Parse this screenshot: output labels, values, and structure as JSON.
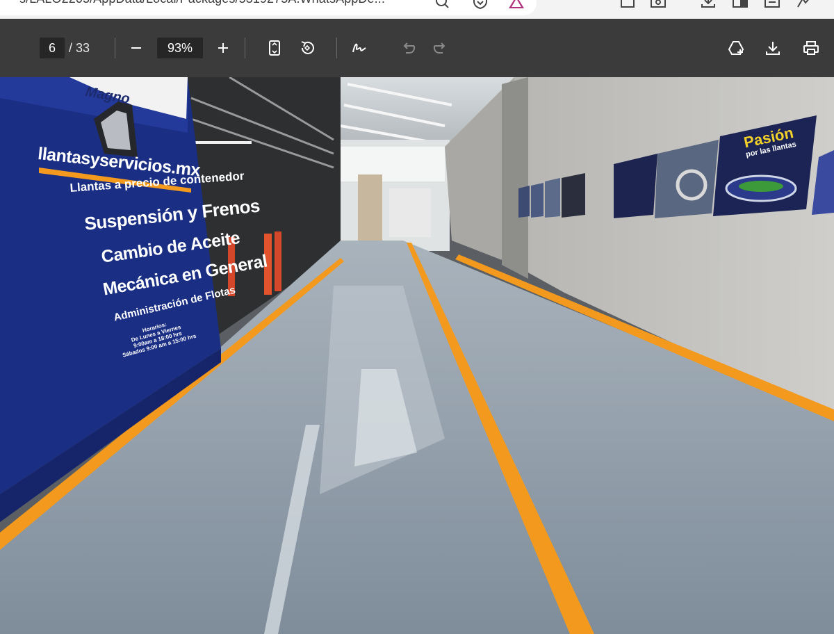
{
  "browser": {
    "address": "s/LALO2205/AppData/Local/Packages/5319275A.WhatsAppDe...",
    "icons": [
      "search-icon",
      "shield-icon",
      "warning-triangle-icon",
      "extensions-icon",
      "screenshot-icon",
      "downloads-icon",
      "split-screen-icon",
      "collections-icon",
      "copilot-icon"
    ]
  },
  "toolbar": {
    "current_page": "6",
    "page_total": "/ 33",
    "zoom": "93%",
    "icons": [
      "zoom-out-icon",
      "zoom-in-icon",
      "fit-page-icon",
      "rotate-icon",
      "draw-icon",
      "undo-icon",
      "redo-icon",
      "add-to-drive-icon",
      "download-icon",
      "print-icon"
    ]
  },
  "photo": {
    "sign": {
      "brand": "Magno",
      "site": "llantasyservicios.mx",
      "line1": "Llantas a precio de contenedor",
      "line2": "Suspensión y Frenos",
      "line3": "Cambio de Aceite",
      "line4": "Mecánica en General",
      "line5": "Administración de Flotas",
      "hours_title": "Horarios:",
      "hours_1": "De Lunes a Viernes",
      "hours_2": "9:00am a 18:00 hrs",
      "hours_3": "Sábados 9:00 am a 15:00 hrs"
    },
    "poster": {
      "title": "Pasión",
      "subtitle": "por las llantas"
    },
    "colors": {
      "sign_blue": "#1f3590",
      "floor": "#8e9ba8",
      "stripe": "#f39a1e",
      "wall": "#c9c8c4"
    }
  }
}
